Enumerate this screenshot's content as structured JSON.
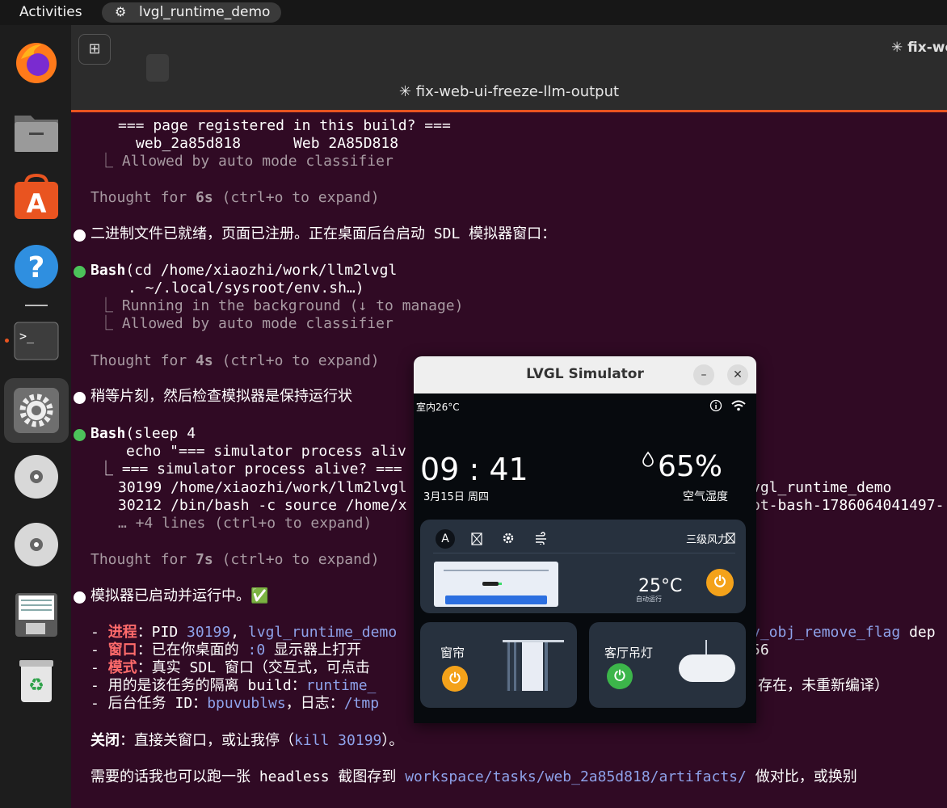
{
  "topbar": {
    "activities": "Activities",
    "app_name": "lvgl_runtime_demo"
  },
  "dock": {
    "items": [
      {
        "icon": "firefox-icon"
      },
      {
        "icon": "files-icon"
      },
      {
        "icon": "app-center-icon"
      },
      {
        "icon": "help-icon"
      },
      {
        "icon": "terminal-icon"
      },
      {
        "icon": "settings-icon"
      },
      {
        "icon": "disc-icon"
      },
      {
        "icon": "disc-icon"
      },
      {
        "icon": "text-editor-icon"
      },
      {
        "icon": "trash-icon"
      }
    ]
  },
  "terminal": {
    "tab_right": "✳ fix-we",
    "tab_title": "✳ fix-web-ui-freeze-llm-output",
    "lines": {
      "l1": "=== page registered in this build? ===",
      "l2": "web_2a85d818      Web 2A85D818",
      "l3": "⎿ Allowed by auto mode classifier",
      "t1a": "Thought for ",
      "t1b": "6s",
      "t1c": " (ctrl+o to expand)",
      "m1": "二进制文件已就绪，页面已注册。正在桌面后台启动 SDL 模拟器窗口：",
      "b1a": "Bash",
      "b1b": "(cd /home/xiaozhi/work/llm2lvgl",
      "b1c": ". ~/.local/sysroot/env.sh…)",
      "b1d": "⎿ Running in the background (↓ to manage)",
      "b1e": "⎿ Allowed by auto mode classifier",
      "t2a": "Thought for ",
      "t2b": "4s",
      "t2c": " (ctrl+o to expand)",
      "m2": "稍等片刻，然后检查模拟器是保持运行状",
      "b2a": "Bash",
      "b2b": "(sleep 4",
      "b2c": "echo \"=== simulator process aliv",
      "b2d": "⎿ === simulator process alive? ===",
      "b2e": "30199 /home/xiaozhi/work/llm2lvgl",
      "b2e2": "vgl_runtime_demo",
      "b2f": "30212 /bin/bash -c source /home/x",
      "b2f2": "ot-bash-1786064041497-",
      "b2g": "… +4 lines (ctrl+o to expand)",
      "t3a": "Thought for ",
      "t3b": "7s",
      "t3c": " (ctrl+o to expand)",
      "m3": "模拟器已启动并运行中。✅",
      "p1a": "- ",
      "p1b": "进程",
      "p1c": "：PID ",
      "p1d": "30199",
      "p1e": ", ",
      "p1f": "lvgl_runtime_demo",
      "p1g": "v_obj_remove_flag",
      "p1h": " dep",
      "p2a": "- ",
      "p2b": "窗口",
      "p2c": "：已在你桌面的 ",
      "p2d": ":0",
      "p2e": " 显示器上打开",
      "p2f": "56",
      "p3a": "- ",
      "p3b": "模式",
      "p3c": "：真实 SDL 窗口（交互式，可点击",
      "p4a": "- 用的是该任务的隔离 build：",
      "p4b": "runtime_",
      "p4c": "存在，未重新编译）",
      "p5a": "- 后台任务 ID：",
      "p5b": "bpuvublws",
      "p5c": "，日志：",
      "p5d": "/tmp",
      "c1a": "关闭",
      "c1b": "：直接关窗口，或让我停（",
      "c1c": "kill 30199",
      "c1d": "）。",
      "c2a": "需要的话我也可以跑一张 headless 截图存到 ",
      "c2b": "workspace/tasks/web_2a85d818/artifacts/",
      "c2c": " 做对比，或换别"
    }
  },
  "simulator": {
    "title": "LVGL Simulator",
    "min_icon": "minimize-icon",
    "close_icon": "close-icon",
    "status_left": "室内26°C",
    "time_h": "09",
    "time_sep": ":",
    "time_m": "41",
    "date": "3月15日 周四",
    "humidity": "65%",
    "humidity_label": "空气湿度",
    "ac": {
      "mode_label": "A",
      "fan_label": "三级风力",
      "temp": "25°C",
      "mode_text": "自动运行",
      "power_color": "#f4a21a"
    },
    "curtain": {
      "label": "窗帘",
      "power_color": "#f4a21a"
    },
    "light": {
      "label": "客厅吊灯",
      "power_color": "#3cb54a"
    }
  }
}
